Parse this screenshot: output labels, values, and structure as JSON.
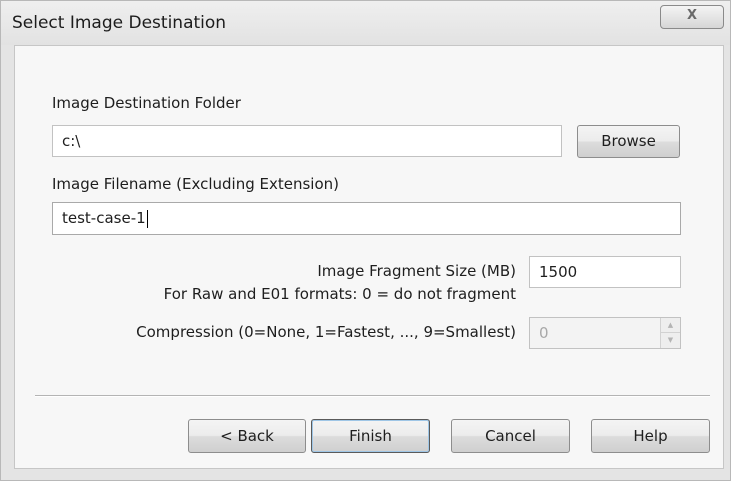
{
  "window": {
    "title": "Select Image Destination",
    "close_glyph": "X"
  },
  "destination_folder": {
    "label": "Image Destination Folder",
    "value": "c:\\",
    "browse_label": "Browse"
  },
  "filename": {
    "label": "Image Filename (Excluding Extension)",
    "value": "test-case-1"
  },
  "fragment": {
    "label": "Image Fragment Size (MB)",
    "note": "For Raw and E01 formats: 0 = do not fragment",
    "value": "1500"
  },
  "compression": {
    "label": "Compression (0=None, 1=Fastest, ..., 9=Smallest)",
    "value": "0",
    "enabled": false,
    "up_icon": "spin-up-icon",
    "down_icon": "spin-down-icon"
  },
  "buttons": {
    "back_label": "< Back",
    "finish_label": "Finish",
    "cancel_label": "Cancel",
    "help_label": "Help"
  }
}
